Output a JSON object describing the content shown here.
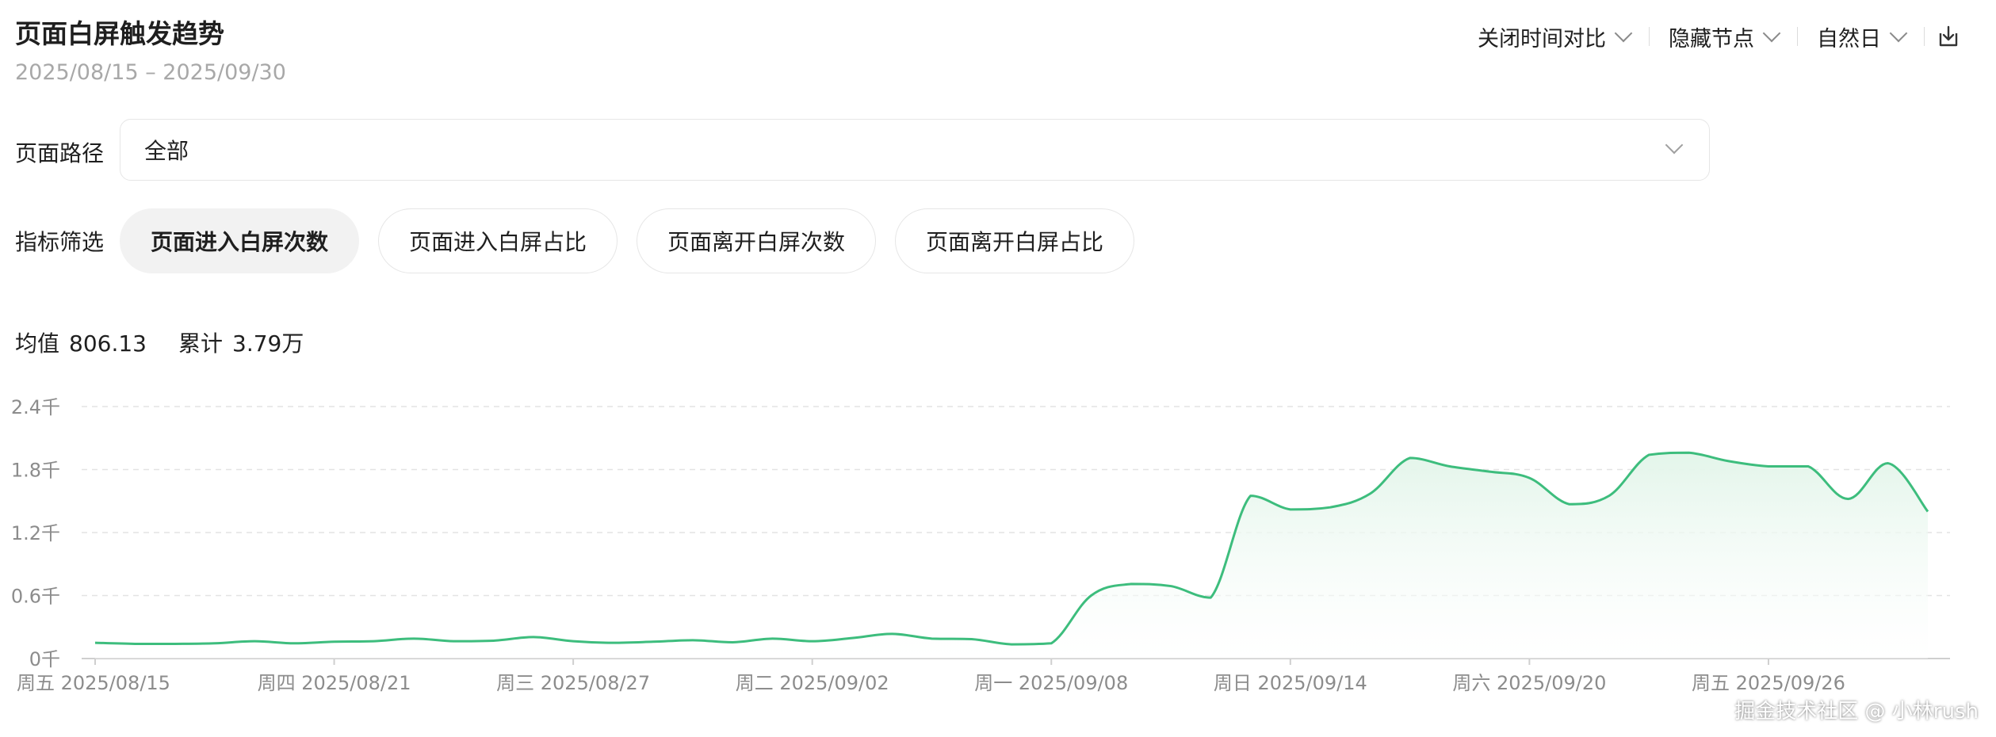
{
  "header": {
    "title": "页面白屏触发趋势",
    "date_range": "2025/08/15 – 2025/09/30"
  },
  "toolbar": {
    "compare": "关闭时间对比",
    "nodes": "隐藏节点",
    "granularity": "自然日",
    "download_icon": "download-icon"
  },
  "filters": {
    "path_label": "页面路径",
    "path_value": "全部",
    "metric_label": "指标筛选",
    "metrics": [
      "页面进入白屏次数",
      "页面进入白屏占比",
      "页面离开白屏次数",
      "页面离开白屏占比"
    ],
    "active_metric": 0
  },
  "stats": {
    "avg_label": "均值",
    "avg_value": "806.13",
    "total_label": "累计",
    "total_value": "3.79万"
  },
  "colors": {
    "line": "#3dbd7d",
    "fill_top": "#e3f5ea",
    "grid": "#e3e3e3",
    "axis_text": "#8c8c8c"
  },
  "chart_data": {
    "type": "area",
    "x": [
      "2025/08/15",
      "2025/08/16",
      "2025/08/17",
      "2025/08/18",
      "2025/08/19",
      "2025/08/20",
      "2025/08/21",
      "2025/08/22",
      "2025/08/23",
      "2025/08/24",
      "2025/08/25",
      "2025/08/26",
      "2025/08/27",
      "2025/08/28",
      "2025/08/29",
      "2025/08/30",
      "2025/08/31",
      "2025/09/01",
      "2025/09/02",
      "2025/09/03",
      "2025/09/04",
      "2025/09/05",
      "2025/09/06",
      "2025/09/07",
      "2025/09/08",
      "2025/09/09",
      "2025/09/10",
      "2025/09/11",
      "2025/09/12",
      "2025/09/13",
      "2025/09/14",
      "2025/09/15",
      "2025/09/16",
      "2025/09/17",
      "2025/09/18",
      "2025/09/19",
      "2025/09/20",
      "2025/09/21",
      "2025/09/22",
      "2025/09/23",
      "2025/09/24",
      "2025/09/25",
      "2025/09/26",
      "2025/09/27",
      "2025/09/28",
      "2025/09/29",
      "2025/09/30"
    ],
    "series": [
      {
        "values": [
          150,
          140,
          140,
          145,
          165,
          145,
          160,
          165,
          190,
          165,
          170,
          205,
          165,
          150,
          160,
          175,
          155,
          190,
          165,
          195,
          235,
          190,
          185,
          135,
          145,
          600,
          710,
          690,
          580,
          1550,
          1420,
          1440,
          1570,
          1910,
          1830,
          1780,
          1720,
          1470,
          1550,
          1940,
          1960,
          1880,
          1830,
          1830,
          1520,
          1860,
          1400
        ]
      }
    ],
    "xlabel": "",
    "ylabel": "",
    "ylim": [
      0,
      2400
    ],
    "y_ticks": [
      0,
      600,
      1200,
      1800,
      2400
    ],
    "y_tick_labels": [
      "0千",
      "0.6千",
      "1.2千",
      "1.8千",
      "2.4千"
    ],
    "x_tick_labels": [
      "周五 2025/08/15",
      "周四 2025/08/21",
      "周三 2025/08/27",
      "周二 2025/09/02",
      "周一 2025/09/08",
      "周日 2025/09/14",
      "周六 2025/09/20",
      "周五 2025/09/26"
    ],
    "x_tick_every": 6,
    "grid": true,
    "legend": "none"
  },
  "watermark": "掘金技术社区 @ 小林rush"
}
